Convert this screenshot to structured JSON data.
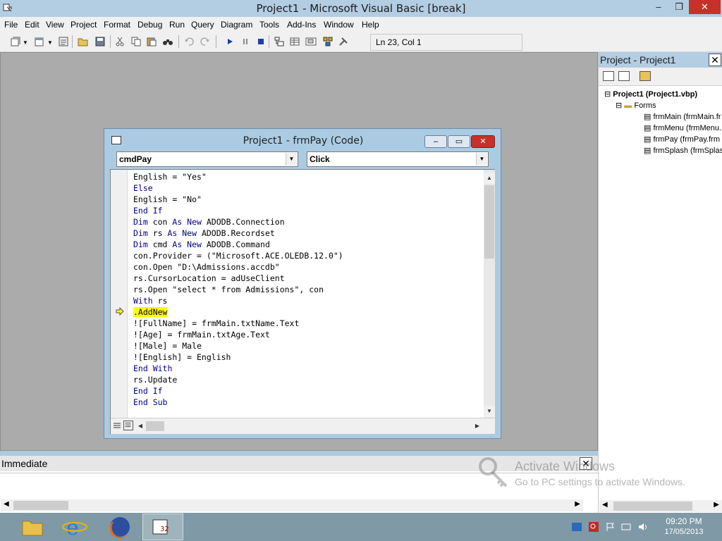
{
  "window": {
    "title": "Project1 - Microsoft Visual Basic [break]",
    "min_glyph": "–",
    "max_glyph": "❐",
    "close_glyph": "✕"
  },
  "menu": [
    "File",
    "Edit",
    "View",
    "Project",
    "Format",
    "Debug",
    "Run",
    "Query",
    "Diagram",
    "Tools",
    "Add-Ins",
    "Window",
    "Help"
  ],
  "toolbar": {
    "position": "Ln 23, Col 1",
    "icons": [
      "add-project-icon",
      "add-form-icon",
      "menu-editor-icon",
      "open-project-icon",
      "save-project-icon",
      "cut-icon",
      "copy-icon",
      "paste-icon",
      "find-icon",
      "undo-icon",
      "redo-icon",
      "start-icon",
      "break-icon",
      "end-icon",
      "project-explorer-icon",
      "properties-window-icon",
      "form-layout-icon",
      "object-browser-icon",
      "toolbox-icon"
    ]
  },
  "code_window": {
    "title": "Project1 - frmPay (Code)",
    "object": "cmdPay",
    "procedure": "Click",
    "min_glyph": "–",
    "max_glyph": "▭",
    "close_glyph": "✕",
    "lines": [
      {
        "text": "English = \"Yes\"",
        "kind": "normal"
      },
      {
        "text": "Else",
        "kind": "keyword"
      },
      {
        "text": "English = \"No\"",
        "kind": "normal"
      },
      {
        "text": "End If",
        "kind": "keyword"
      },
      {
        "parts": [
          {
            "t": "Dim",
            "k": true
          },
          {
            "t": " con ",
            "k": false
          },
          {
            "t": "As New",
            "k": true
          },
          {
            "t": " ADODB.Connection",
            "k": false
          }
        ]
      },
      {
        "parts": [
          {
            "t": "Dim",
            "k": true
          },
          {
            "t": " rs ",
            "k": false
          },
          {
            "t": "As New",
            "k": true
          },
          {
            "t": " ADODB.Recordset",
            "k": false
          }
        ]
      },
      {
        "parts": [
          {
            "t": "Dim",
            "k": true
          },
          {
            "t": " cmd ",
            "k": false
          },
          {
            "t": "As New",
            "k": true
          },
          {
            "t": " ADODB.Command",
            "k": false
          }
        ]
      },
      {
        "text": "con.Provider = (\"Microsoft.ACE.OLEDB.12.0\")",
        "kind": "normal"
      },
      {
        "text": "con.Open \"D:\\Admissions.accdb\"",
        "kind": "normal"
      },
      {
        "text": "rs.CursorLocation = adUseClient",
        "kind": "normal"
      },
      {
        "text": "rs.Open \"select * from Admissions\", con",
        "kind": "normal"
      },
      {
        "parts": [
          {
            "t": "With",
            "k": true
          },
          {
            "t": " rs",
            "k": false
          }
        ]
      },
      {
        "text": ".AddNew",
        "kind": "current"
      },
      {
        "text": "![FullName] = frmMain.txtName.Text",
        "kind": "normal"
      },
      {
        "text": "![Age] = frmMain.txtAge.Text",
        "kind": "normal"
      },
      {
        "text": "![Male] = Male",
        "kind": "normal"
      },
      {
        "text": "![English] = English",
        "kind": "normal"
      },
      {
        "text": "End With",
        "kind": "keyword"
      },
      {
        "text": "rs.Update",
        "kind": "normal"
      },
      {
        "text": "End If",
        "kind": "keyword"
      },
      {
        "text": "End Sub",
        "kind": "keyword"
      }
    ]
  },
  "project": {
    "title": "Project - Project1",
    "close_glyph": "✕",
    "root": "Project1 (Project1.vbp)",
    "folder": "Forms",
    "forms": [
      "frmMain (frmMain.fr",
      "frmMenu (frmMenu.",
      "frmPay (frmPay.frm",
      "frmSplash (frmSplas"
    ]
  },
  "immediate": {
    "title": "Immediate",
    "close_glyph": "✕"
  },
  "activation": {
    "line1": "Activate Windows",
    "line2": "Go to PC settings to activate Windows."
  },
  "taskbar": {
    "time": "09:20 PM",
    "date": "17/05/2013",
    "apps": [
      "file-explorer-icon",
      "internet-explorer-icon",
      "firefox-icon",
      "visual-basic-icon"
    ]
  }
}
